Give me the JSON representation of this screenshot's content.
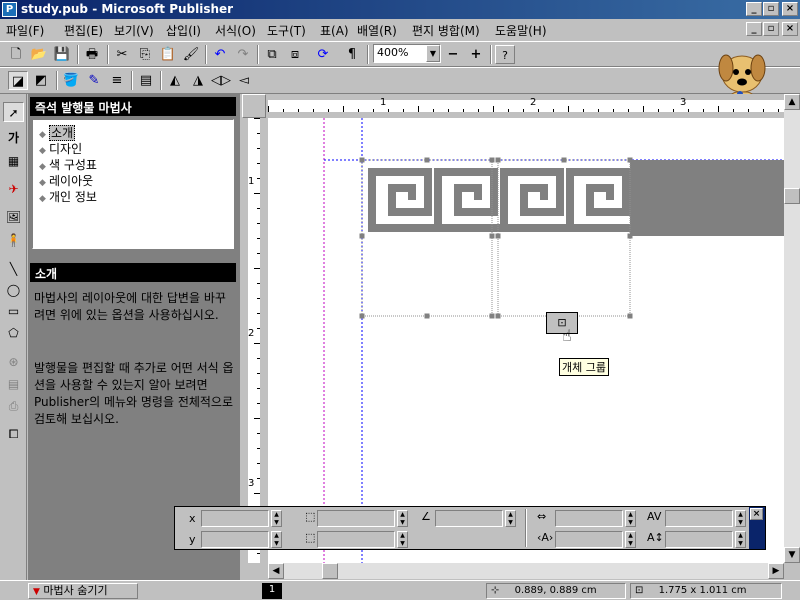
{
  "window": {
    "title": "study.pub - Microsoft Publisher",
    "icon": "publisher-icon"
  },
  "menu": [
    "파일(F)",
    "편집(E)",
    "보기(V)",
    "삽입(I)",
    "서식(O)",
    "도구(T)",
    "표(A)",
    "배열(R)",
    "편지 병합(M)",
    "도움말(H)"
  ],
  "toolbar": {
    "zoom": "400%"
  },
  "wizard": {
    "title": "즉석 발행물 마법사",
    "items": [
      "소개",
      "디자인",
      "색 구성표",
      "레이아웃",
      "개인 정보"
    ],
    "section_title": "소개",
    "para1": "마법사의 레이아웃에 대한 답변을 바꾸려면 위에 있는 옵션을 사용하십시오.",
    "para2": "발행물을 편집할 때 추가로 어떤 서식 옵션을 사용할 수 있는지 알아 보려면 Publisher의 메뉴와 명령을 전체적으로 검토해 보십시오."
  },
  "ruler": {
    "h": [
      "1",
      "2",
      "3"
    ],
    "v": [
      "1",
      "2",
      "3"
    ]
  },
  "canvas": {
    "tooltip": "개체 그룹"
  },
  "measure": {
    "x": "x",
    "y": "y"
  },
  "status": {
    "wizard_toggle": "마법사 숨기기",
    "page": "1",
    "position": "0.889, 0.889 cm",
    "size": "1.775 x 1.011 cm"
  },
  "colors": {
    "title_start": "#0a246a",
    "title_end": "#3a6ea5",
    "frieze": "#808080"
  }
}
